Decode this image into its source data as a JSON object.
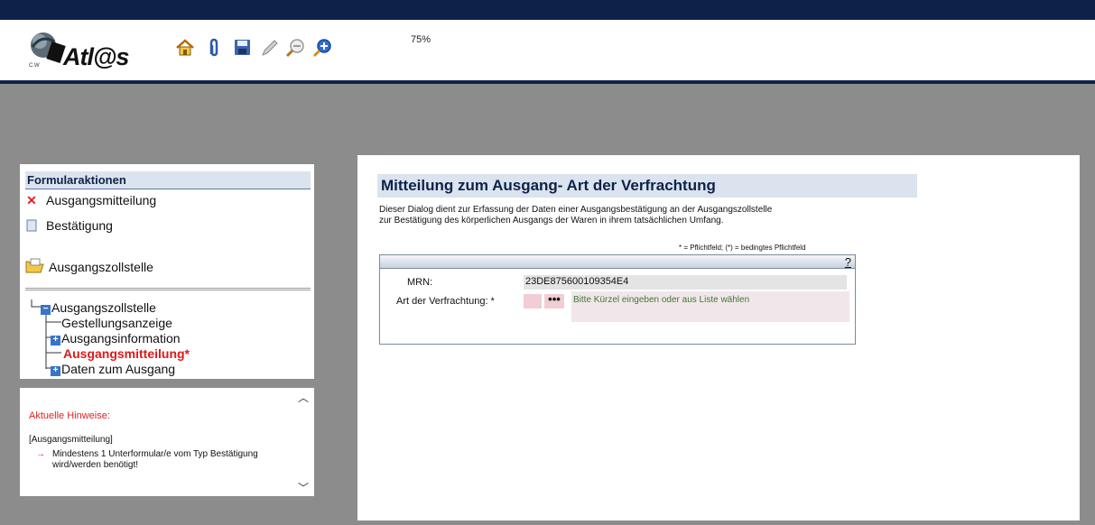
{
  "header": {
    "logo_text": "Atl@s",
    "logo_subtext": "C.W",
    "zoom_level": "75%",
    "toolbar_icons": [
      "home-icon",
      "paperclip-icon",
      "save-icon",
      "pencil-icon",
      "zoom-out-icon",
      "zoom-in-icon"
    ]
  },
  "form_actions": {
    "title": "Formularaktionen",
    "items": [
      {
        "label": "Ausgangsmitteilung",
        "icon": "red-x-icon"
      },
      {
        "label": "Bestätigung",
        "icon": "document-icon"
      }
    ],
    "folder_label": "Ausgangszollstelle"
  },
  "tree": {
    "root": "Ausgangszollstelle",
    "children": [
      {
        "label": "Gestellungsanzeige",
        "expandable": false
      },
      {
        "label": "Ausgangsinformation",
        "expandable": true
      },
      {
        "label": "Ausgangsmitteilung*",
        "expandable": false,
        "active": true
      },
      {
        "label": "Daten zum Ausgang",
        "expandable": true
      }
    ]
  },
  "hints": {
    "title": "Aktuelle Hinweise:",
    "section": "[Ausgangsmitteilung]",
    "message": "Mindestens 1 Unterformular/e vom Typ Bestätigung wird/werden benötigt!"
  },
  "main": {
    "title": "Mitteilung zum Ausgang- Art der Verfrachtung",
    "description_line1": "Dieser Dialog dient zur Erfassung der Daten einer Ausgangsbestätigung an der Ausgangszollstelle",
    "description_line2": "zur Bestätigung des körperlichen Ausgangs der Waren in ihrem tatsächlichen Umfang.",
    "required_note": "* = Pflichtfeld; (*) = bedingtes Pflichtfeld",
    "help": "?",
    "fields": {
      "mrn_label": "MRN:",
      "mrn_value": "23DE875600109354E4",
      "art_label": "Art der Verfrachtung: *",
      "art_button": "•••",
      "art_hint": "Bitte Kürzel eingeben oder aus Liste wählen"
    }
  },
  "colors": {
    "navy": "#0d2249",
    "required_field": "#f1cdd4",
    "active_tree_item": "#e01818",
    "hint_title": "#dd2222"
  }
}
